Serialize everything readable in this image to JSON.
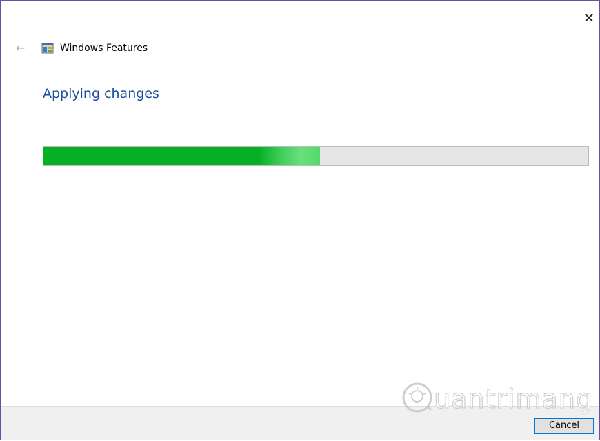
{
  "window": {
    "title": "Windows Features",
    "close_glyph": "✕",
    "back_glyph": "←"
  },
  "main": {
    "heading": "Applying changes",
    "progress": {
      "value_fraction": 0.507,
      "fill_color": "#06b025",
      "track_color": "#e6e6e6"
    }
  },
  "footer": {
    "cancel_label": "Cancel"
  },
  "watermark": {
    "text": "uantrimang"
  },
  "colors": {
    "accent": "#0078d7",
    "heading": "#1a4ea0"
  },
  "icons": {
    "app": "windows-features-icon",
    "back": "back-arrow-icon",
    "close": "close-icon",
    "watermark_logo": "lightbulb-icon"
  }
}
